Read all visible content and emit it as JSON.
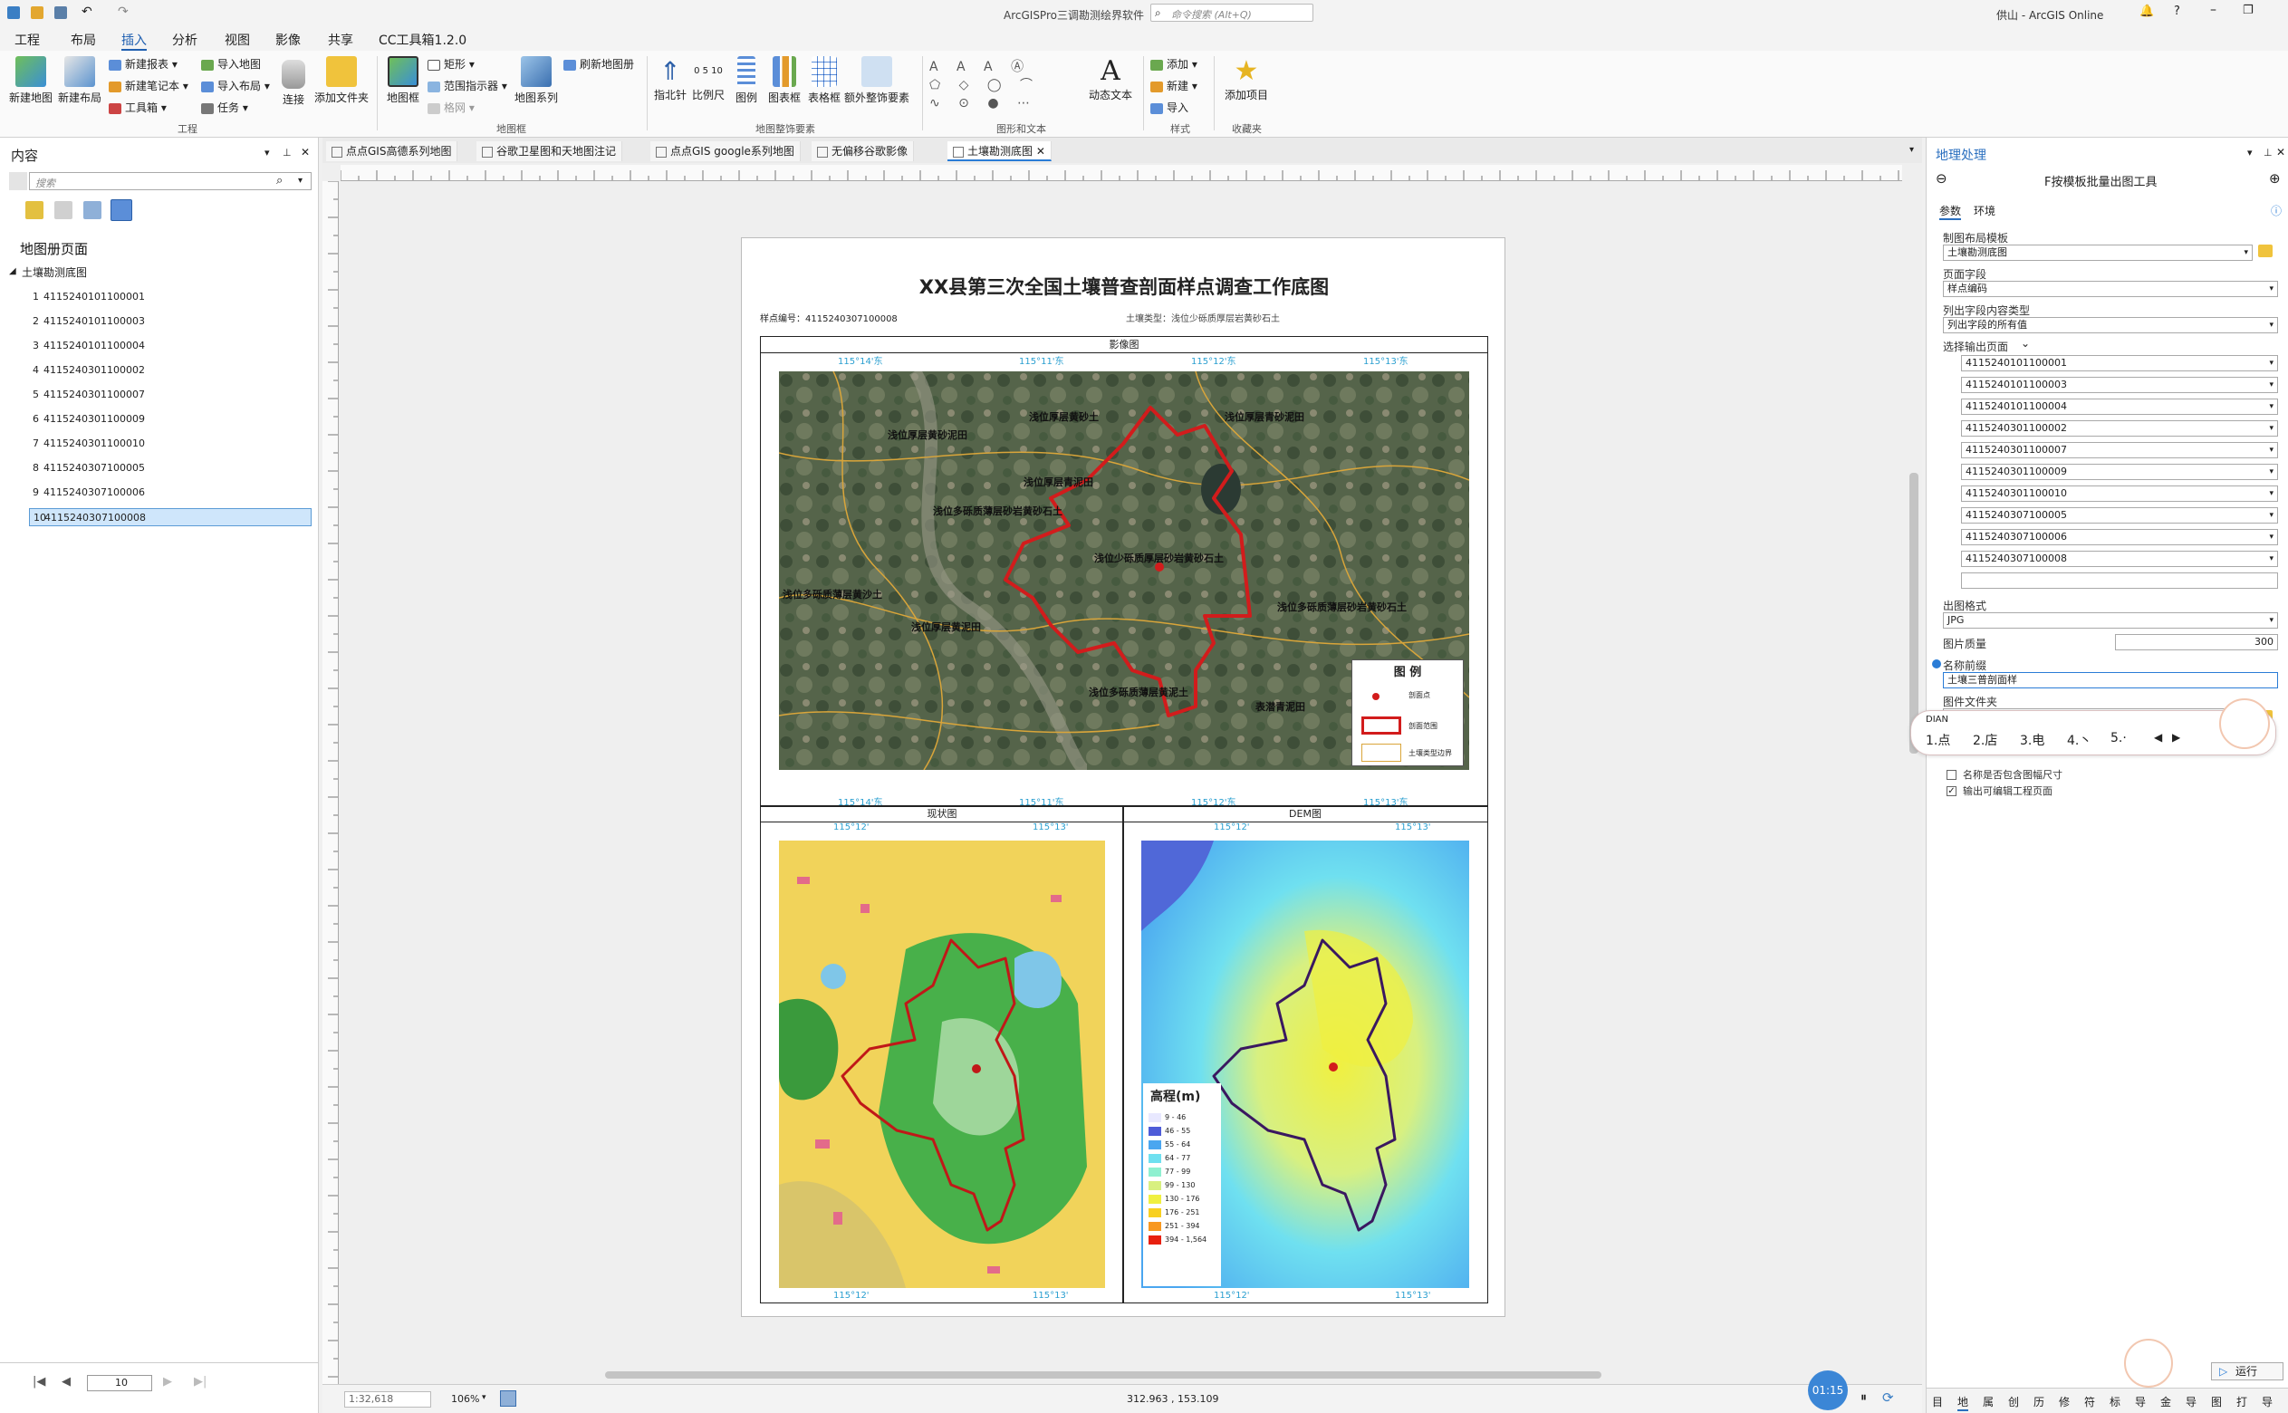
{
  "app": {
    "title": "ArcGISPro三调勘测绘界软件",
    "search_placeholder": "命令搜索 (Alt+Q)",
    "user": "供山 - ArcGIS Online"
  },
  "menu": [
    "工程",
    "布局",
    "插入",
    "分析",
    "视图",
    "影像",
    "共享",
    "CC工具箱1.2.0"
  ],
  "ribbon": {
    "big1": [
      {
        "label": "新建地图",
        "icon": "map-icon"
      },
      {
        "label": "新建布局",
        "icon": "layout-icon"
      }
    ],
    "small1": [
      "新建报表",
      "新建笔记本",
      "工具箱"
    ],
    "small2": [
      "导入地图",
      "导入布局",
      "任务"
    ],
    "connect": "连接",
    "addfolder": "添加文件夹",
    "group_project": "工程",
    "mapframe": "地图框",
    "small3": [
      "矩形",
      "范围指示器",
      "格网"
    ],
    "mapseries": "地图系列",
    "refresh": "刷新地图册",
    "group_mapframe": "地图框",
    "surround": [
      "指北针",
      "比例尺",
      "图例",
      "图表框",
      "表格框",
      "额外整饰要素"
    ],
    "group_surround": "地图整饰要素",
    "dyntext": "动态文本",
    "group_graphics": "图形和文本",
    "styles": [
      "添加",
      "新建",
      "导入"
    ],
    "group_styles": "样式",
    "additem": "添加项目",
    "group_fav": "收藏夹"
  },
  "left": {
    "title": "内容",
    "search_placeholder": "搜索",
    "section": "地图册页面",
    "root": "土壤勘测底图",
    "pages": [
      "4115240101100001",
      "4115240101100003",
      "4115240101100004",
      "4115240301100002",
      "4115240301100007",
      "4115240301100009",
      "4115240301100010",
      "4115240307100005",
      "4115240307100006",
      "4115240307100008"
    ],
    "nav_page": "10"
  },
  "tabs": [
    "点点GIS高德系列地图",
    "谷歌卫星图和天地图注记",
    "点点GIS google系列地图",
    "无偏移谷歌影像",
    "土壤勘测底图"
  ],
  "layout": {
    "title": "XX县第三次全国土壤普查剖面样点调查工作底图",
    "sample": "样点编号：4115240307100008",
    "soiltype": "土壤类型：浅位少砾质厚层岩黄砂石土",
    "frame1": "影像图",
    "frame2": "现状图",
    "frame3": "DEM图",
    "top_coords": [
      "115°11'东",
      "115°12'东",
      "115°13'东",
      "115°14'东"
    ],
    "mid_coords": [
      "115°12'",
      "115°13'"
    ],
    "legend_title": "图 例",
    "legend_items": [
      "剖面点",
      "剖面范围",
      "土壤类型边界"
    ],
    "sat_labels": [
      "浅位厚层黄砂泥田",
      "浅位厚层黄砂土",
      "浅位厚层青砂泥田",
      "浅位厚层青泥田",
      "浅位多砾质薄层砂岩黄砂石土",
      "浅位少砾质厚层砂岩黄砂石土",
      "浅位多砾质薄层黄沙土",
      "浅位多砾质薄层砂岩黄砂石土",
      "浅位厚层黄泥田",
      "浅位多砾质薄层黄泥土",
      "表潜青泥田"
    ],
    "elev_title": "高程(m)",
    "elev": [
      "9 - 46",
      "46 - 55",
      "55 - 64",
      "64 - 77",
      "77 - 99",
      "99 - 130",
      "130 - 176",
      "176 - 251",
      "251 - 394",
      "394 - 1,564"
    ],
    "elev_colors": [
      "#e8e8ff",
      "#4e5cd8",
      "#4aa6f0",
      "#6fe0f0",
      "#8ff0d0",
      "#d8f080",
      "#f0f040",
      "#f8d020",
      "#f89820",
      "#e82010"
    ]
  },
  "status": {
    "scale": "1:32,618",
    "zoom": "106%",
    "coords": "312.963 , 153.109",
    "timer": "01:15"
  },
  "right": {
    "title": "地理处理",
    "tool": "F按模板批量出图工具",
    "tabs": [
      "参数",
      "环境"
    ],
    "f1_label": "制图布局模板",
    "f1_value": "土壤勘测底图",
    "f2_label": "页面字段",
    "f2_value": "样点编码",
    "f3_label": "列出字段内容类型",
    "f3_value": "列出字段的所有值",
    "f4_label": "选择输出页面",
    "pages": [
      "4115240101100001",
      "4115240101100003",
      "4115240101100004",
      "4115240301100002",
      "4115240301100007",
      "4115240301100009",
      "4115240301100010",
      "4115240307100005",
      "4115240307100006",
      "4115240307100008"
    ],
    "fmt_label": "出图格式",
    "fmt_value": "JPG",
    "qual_label": "图片质量",
    "qual_value": "300",
    "prefix_label": "名称前缀",
    "prefix_value": "土壤三普剖面样",
    "folder_label": "图件文件夹",
    "chk1": "名称是否包含图幅尺寸",
    "chk2": "输出可编辑工程页面",
    "run": "运行",
    "ime": [
      "1.点",
      "2.店",
      "3.电",
      "4.丶",
      "5.·"
    ],
    "ime_input": "DIAN",
    "bottom_tabs": [
      "目",
      "地",
      "属",
      "创",
      "历",
      "修",
      "符",
      "标",
      "导",
      "金",
      "导",
      "图",
      "打",
      "导"
    ]
  }
}
